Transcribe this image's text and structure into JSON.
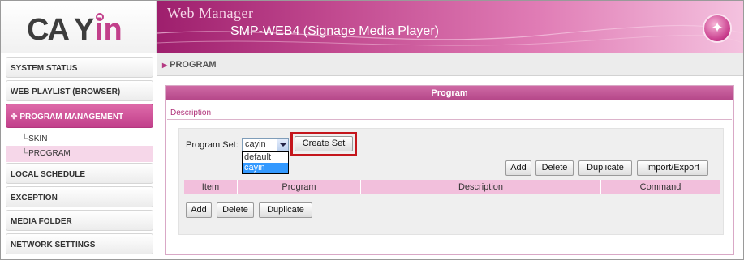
{
  "header": {
    "title": "Web Manager",
    "subtitle": "SMP-WEB4 (Signage Media Player)",
    "logo_text": "CAYIN"
  },
  "breadcrumb": {
    "text": "PROGRAM"
  },
  "sidebar": {
    "items": [
      {
        "label": "SYSTEM STATUS"
      },
      {
        "label": "WEB PLAYLIST (BROWSER)"
      },
      {
        "label": "PROGRAM MANAGEMENT"
      },
      {
        "label": "LOCAL SCHEDULE"
      },
      {
        "label": "EXCEPTION"
      },
      {
        "label": "MEDIA FOLDER"
      },
      {
        "label": "NETWORK SETTINGS"
      }
    ],
    "subitems": [
      {
        "label": "SKIN"
      },
      {
        "label": "PROGRAM"
      }
    ]
  },
  "panel": {
    "title": "Program",
    "description_link": "Description",
    "program_set_label": "Program Set:",
    "program_set_value": "cayin",
    "program_set_options": [
      "default",
      "cayin"
    ],
    "create_set_label": "Create Set",
    "toolbar": {
      "add": "Add",
      "delete": "Delete",
      "duplicate": "Duplicate",
      "import_export": "Import/Export"
    },
    "columns": [
      "Item",
      "Program",
      "Description",
      "Command"
    ],
    "bottom_toolbar": {
      "add": "Add",
      "delete": "Delete",
      "duplicate": "Duplicate"
    }
  },
  "colors": {
    "brand_pink": "#c2408b",
    "highlight_red": "#c4161c",
    "selected_option": "#3399ff"
  }
}
